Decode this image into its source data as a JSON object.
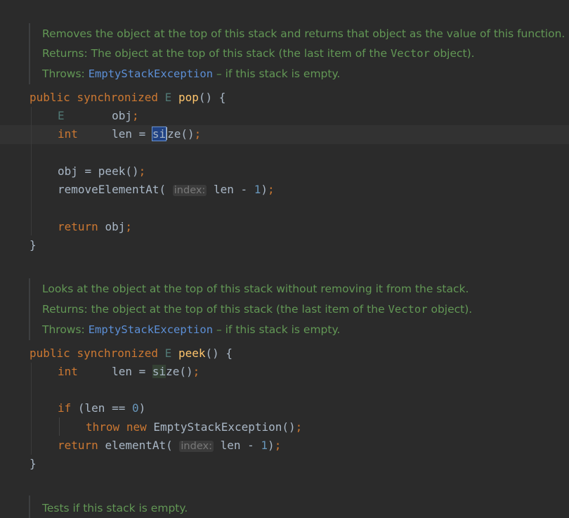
{
  "doc_blocks": [
    {
      "lines": [
        "Removes the object at the top of this stack and returns that object as the value of this function.",
        [
          "Returns: The object at the top of this stack (the last item of the ",
          "Vector",
          " object)."
        ],
        [
          "Throws: ",
          "EmptyStackException",
          " – if this stack is empty."
        ]
      ]
    },
    {
      "lines": [
        "Looks at the object at the top of this stack without removing it from the stack.",
        [
          "Returns: the object at the top of this stack (the last item of the ",
          "Vector",
          " object)."
        ],
        [
          "Throws: ",
          "EmptyStackException",
          " – if this stack is empty."
        ]
      ]
    },
    {
      "lines": [
        "Tests if this stack is empty."
      ]
    }
  ],
  "pop": {
    "kw_public": "public",
    "kw_synchronized": "synchronized",
    "type_e": "E",
    "name": "pop",
    "sig_end": "() {",
    "l1_type": "E",
    "l1_var": "obj",
    "l1_semi": ";",
    "l2_type": "int",
    "l2_var": "len = ",
    "l2_sel": "si",
    "l2_rest": "ze()",
    "l2_semi": ";",
    "l3_code": "obj = peek()",
    "l3_semi": ";",
    "l4_call": "removeElementAt(",
    "l4_hint": "index:",
    "l4_expr": "len - ",
    "l4_num": "1",
    "l4_close": ")",
    "l4_semi": ";",
    "l5_kw": "return",
    "l5_var": "obj",
    "l5_semi": ";",
    "close": "}"
  },
  "peek": {
    "kw_public": "public",
    "kw_synchronized": "synchronized",
    "type_e": "E",
    "name": "peek",
    "sig_end": "() {",
    "l1_type": "int",
    "l1_var": "len = ",
    "l1_sel": "si",
    "l1_rest": "ze()",
    "l1_semi": ";",
    "l2_kw": "if",
    "l2_open": "(len ",
    "l2_op": "==",
    "l2_space": " ",
    "l2_num": "0",
    "l2_close": ")",
    "l3_kw1": "throw",
    "l3_kw2": "new",
    "l3_call": "EmptyStackException()",
    "l3_semi": ";",
    "l4_kw": "return",
    "l4_call": "elementAt(",
    "l4_hint": "index:",
    "l4_expr": "len - ",
    "l4_num": "1",
    "l4_close": ")",
    "l4_semi": ";",
    "close": "}"
  },
  "colors": {
    "background": "#2b2b2b",
    "doc_text": "#629755",
    "keyword": "#cc7832",
    "method_decl": "#ffc66d",
    "number": "#6897bb",
    "link": "#5c8fd6"
  }
}
